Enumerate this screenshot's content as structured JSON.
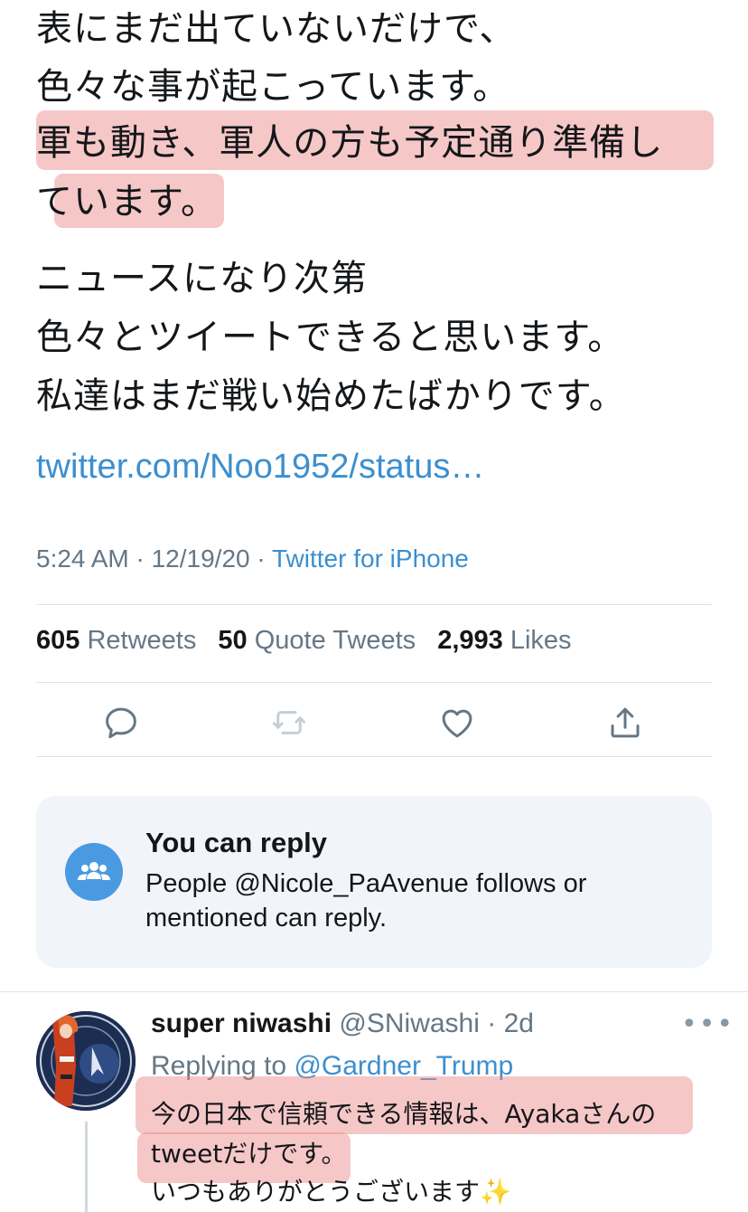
{
  "tweet": {
    "lines": [
      "表にまだ出ていないだけで、",
      "色々な事が起こっています。",
      "軍も動き、軍人の方も予定通り準備し",
      "ています。",
      "ニュースになり次第",
      "色々とツイートできると思います。",
      "私達はまだ戦い始めたばかりです。"
    ],
    "link": "twitter.com/Noo1952/status…",
    "time": "5:24 AM · 12/19/20 · ",
    "source": "Twitter for iPhone"
  },
  "stats": {
    "retweets_count": "605",
    "retweets_label": "Retweets",
    "quotes_count": "50",
    "quotes_label": "Quote Tweets",
    "likes_count": "2,993",
    "likes_label": "Likes"
  },
  "actions": {
    "reply_icon": "comment-icon",
    "retweet_icon": "retweet-icon",
    "like_icon": "heart-icon",
    "share_icon": "share-icon"
  },
  "reply_notice": {
    "title": "You can reply",
    "body": "People @Nicole_PaAvenue follows or mentioned can reply.",
    "icon": "people-icon"
  },
  "reply": {
    "name": "super niwashi",
    "handle": "@SNiwashi",
    "sep": " · ",
    "age": "2d",
    "more": "•••",
    "replying_prefix": "Replying to ",
    "replying_to": "@Gardner_Trump",
    "lines": [
      "今の日本で信頼できる情報は、Ayakaさんの",
      "tweetだけです。",
      "いつもありがとうございます"
    ],
    "emoji": "✨",
    "avatar_text": "UNITED STATES SPACE FORCE · DEPARTMENT OF THE AIR FORCE"
  },
  "colors": {
    "link": "#3b8fd0",
    "highlight": "#ec8282",
    "muted": "#657786",
    "card_bg": "#f1f5f9",
    "icon_blue": "#4a9ae1"
  }
}
